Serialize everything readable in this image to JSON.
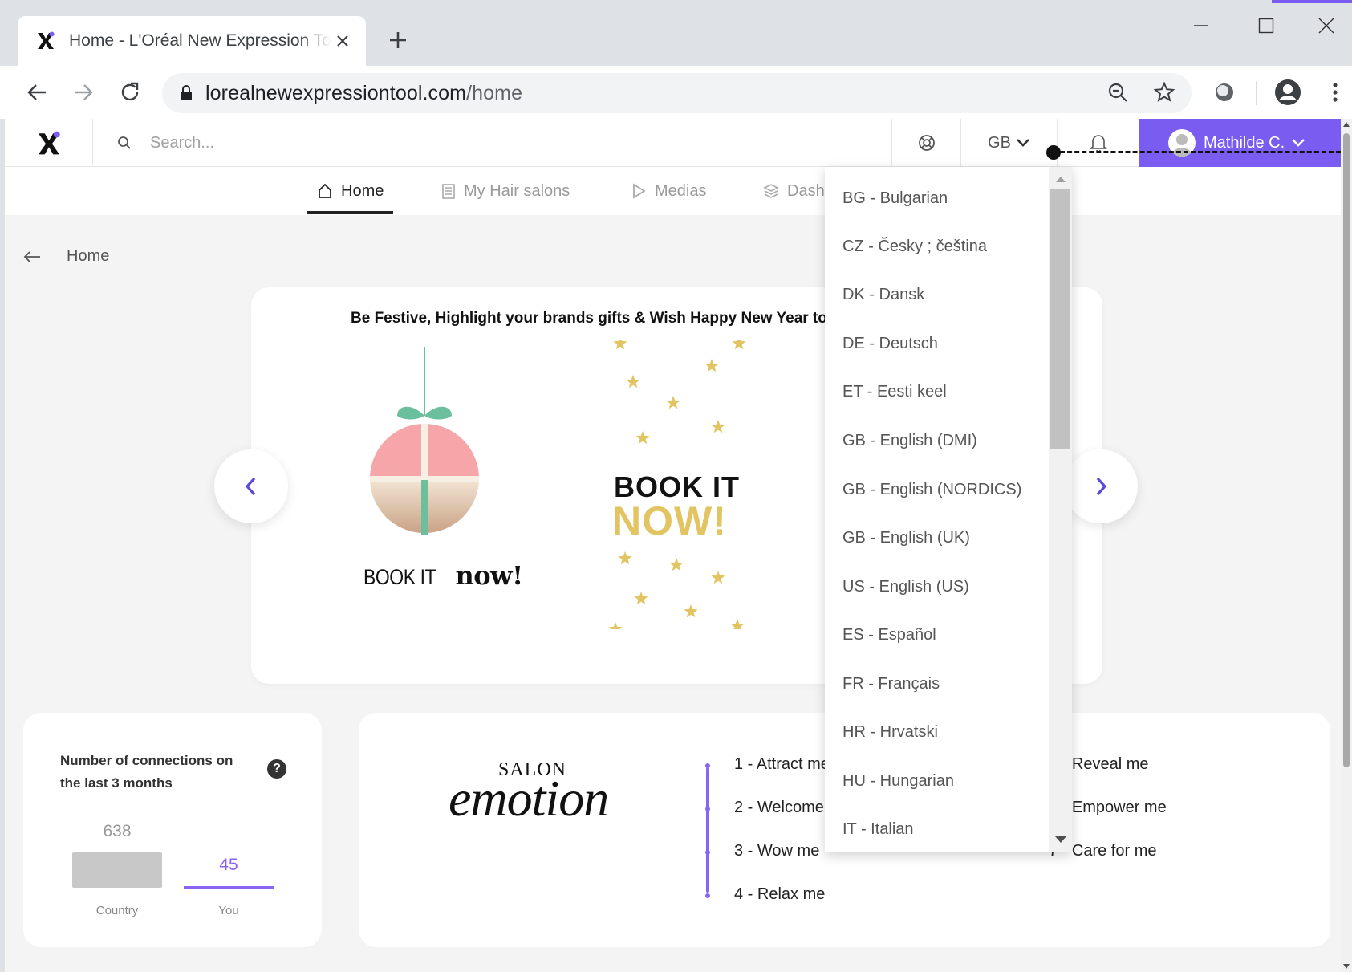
{
  "browser": {
    "tab_title": "Home - L'Oréal New Expression Tool",
    "url_domain": "lorealnewexpressiontool.com",
    "url_path": "/home"
  },
  "header": {
    "search_placeholder": "Search...",
    "language_code": "GB",
    "user_name": "Mathilde C."
  },
  "nav": {
    "items": [
      {
        "label": "Home",
        "icon": "home-icon",
        "active": true
      },
      {
        "label": "My Hair salons",
        "icon": "building-icon",
        "active": false
      },
      {
        "label": "Medias",
        "icon": "play-icon",
        "active": false
      },
      {
        "label": "Dashboard",
        "icon": "layers-icon",
        "active": false
      }
    ]
  },
  "breadcrumb": {
    "label": "Home"
  },
  "banner": {
    "title": "Be Festive, Highlight your brands gifts & Wish Happy New Year to your clients",
    "ornament_caption_a": "BOOK IT",
    "ornament_caption_b": "now",
    "ornament_caption_c": "!",
    "headline_1": "BOOK IT",
    "headline_2": "NOW!"
  },
  "stats": {
    "title": "Number of connections on the last 3 months",
    "country_value": "638",
    "country_label": "Country",
    "you_value": "45",
    "you_label": "You"
  },
  "salon_emotion": {
    "logo_top": "SALON",
    "logo_main": "emotion",
    "steps": [
      "1 - Attract me",
      "2 - Welcome me",
      "3 - Wow me",
      "4 - Relax me",
      "5 - Reveal me",
      "6 - Empower me",
      "7 - Care for me"
    ]
  },
  "language_dropdown": {
    "options": [
      "BG - Bulgarian",
      "CZ - Česky ; čeština",
      "DK - Dansk",
      "DE - Deutsch",
      "ET - Eesti keel",
      "GB - English (DMI)",
      "GB - English (NORDICS)",
      "GB - English (UK)",
      "US - English (US)",
      "ES - Español",
      "FR - Français",
      "HR - Hrvatski",
      "HU - Hungarian",
      "IT - Italian"
    ]
  },
  "colors": {
    "accent": "#7b5cf0",
    "gold": "#e2c562",
    "ornament_pink": "#f6a6a8",
    "ornament_green": "#6bbf9c"
  }
}
